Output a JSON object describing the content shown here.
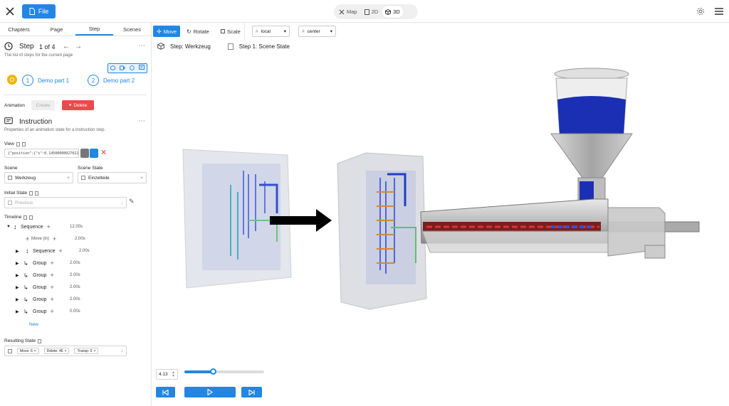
{
  "topbar": {
    "file_label": "File",
    "modes": [
      {
        "label": "Map"
      },
      {
        "label": "2D"
      },
      {
        "label": "3D"
      }
    ]
  },
  "sidebar": {
    "tabs": [
      "Chapters",
      "Page",
      "Step",
      "Scenes"
    ],
    "step": {
      "title": "Step",
      "counter": "1 of 4",
      "subtitle": "The list of steps for the current page"
    },
    "parts": [
      {
        "num": "1",
        "label": "Demo part 1"
      },
      {
        "num": "2",
        "label": "Demo part 2"
      }
    ],
    "animation": {
      "label": "Animation",
      "create": "Create",
      "delete": "Delete"
    },
    "instruction": {
      "title": "Instruction",
      "subtitle": "Properties of an animation state for a instruction step."
    },
    "view": {
      "label": "View",
      "value": "{\"position\":{\"x\":0.14500000027021"
    },
    "scene": {
      "label": "Scene",
      "value": "Werkzeug"
    },
    "scene_state": {
      "label": "Scene State",
      "value": "Einzelteile"
    },
    "initial_state": {
      "label": "Initial State",
      "placeholder": "Previous"
    },
    "timeline": {
      "label": "Timeline",
      "rows": [
        {
          "label": "Sequence",
          "dur": "12.00s"
        },
        {
          "label": "Move (in)",
          "dur": "2.00s"
        },
        {
          "label": "Sequence",
          "dur": "2.00s"
        },
        {
          "label": "Group",
          "dur": "2.00s"
        },
        {
          "label": "Group",
          "dur": "2.00s"
        },
        {
          "label": "Group",
          "dur": "2.00s"
        },
        {
          "label": "Group",
          "dur": "2.00s"
        },
        {
          "label": "Group",
          "dur": "0.00s"
        }
      ],
      "new": "New"
    },
    "resulting": {
      "label": "Resulting State",
      "chips": [
        "Move: 6",
        "Delete: 46",
        "Transp: 0"
      ]
    }
  },
  "toolbar": {
    "move": "Move",
    "rotate": "Rotate",
    "scale": "Scale",
    "space": "local",
    "pivot": "center"
  },
  "breadcrumb": {
    "step": "Step: Werkzeug",
    "state": "Step 1: Scene State"
  },
  "player": {
    "time": "4.13",
    "progress": 0.36
  },
  "colors": {
    "accent": "#2186e4",
    "danger": "#e94b4b",
    "gold": "#f0b400"
  }
}
